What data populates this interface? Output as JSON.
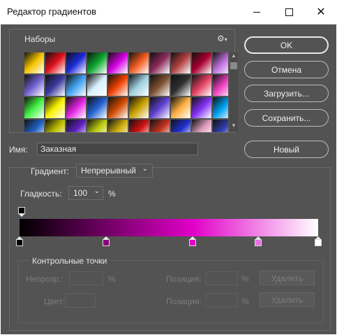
{
  "window": {
    "title": "Редактор градиентов"
  },
  "presets": {
    "label": "Наборы",
    "settings_icon": "gear-icon",
    "swatches": [
      [
        "#f7c400",
        "#e0101a",
        "#1a2ad8",
        "#0aa62e",
        "#d400e0",
        "#f05a20",
        "#8a2a5a",
        "#b04040",
        "#a80030",
        "#c070e0"
      ],
      [
        "#7060d0",
        "#3a3aa0",
        "#40a0f0",
        "#d8f0ff",
        "#f04000",
        "#a0d0e0",
        "#7c5030",
        "#303030",
        "#e04060",
        "#f040c0"
      ],
      [
        "#40f040",
        "#f8f000",
        "#e020e0",
        "#2060d0",
        "#d04a00",
        "#c8a000",
        "#6040d0",
        "#ffb040",
        "#8030f0",
        "#00a0f0"
      ],
      [
        "#2060c0",
        "#c0c000",
        "#6020c0",
        "#c0d010",
        "#d0b010",
        "#d01010",
        "#c03020",
        "#2030d0",
        "#e0a0c0",
        "#3040b0"
      ]
    ]
  },
  "buttons": {
    "ok": "OK",
    "cancel": "Отмена",
    "load": "Загрузить...",
    "save": "Сохранить...",
    "new": "Новый"
  },
  "name": {
    "label": "Имя:",
    "value": "Заказная"
  },
  "gradient": {
    "type_label": "Градиент:",
    "type_value": "Непрерывный",
    "smoothness_label": "Гладкость:",
    "smoothness_value": "100",
    "smoothness_unit": "%",
    "colors": [
      "#000000",
      "#e100c8",
      "#ffffff"
    ],
    "color_stops": [
      {
        "pos": 0.0,
        "color": "#000000"
      },
      {
        "pos": 0.29,
        "color": "#8a007a"
      },
      {
        "pos": 0.58,
        "color": "#e100c8"
      },
      {
        "pos": 0.8,
        "color": "#e870e0"
      },
      {
        "pos": 1.0,
        "color": "#ffffff"
      }
    ],
    "opacity_stops": [
      {
        "pos": 0.0,
        "color": "#000000"
      }
    ]
  },
  "control_points": {
    "title": "Контрольные точки",
    "opacity_label": "Непрозр.:",
    "percent": "%",
    "position_label": "Позиция:",
    "delete_label": "Удалить",
    "color_label": "Цвет:"
  }
}
